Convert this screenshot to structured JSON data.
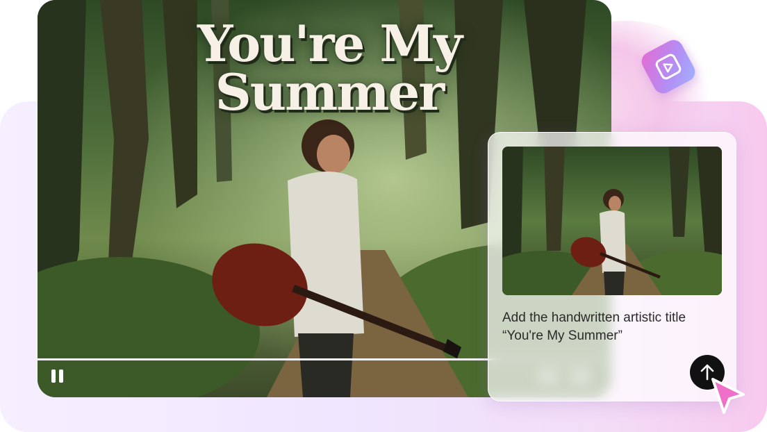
{
  "video": {
    "title_line1": "You're My",
    "title_line2": "Summer",
    "progress": 0.8,
    "play_state": "paused",
    "pause_icon": "pause-icon"
  },
  "logo": {
    "icon": "play-triangle-icon",
    "colors": [
      "#e46bd4",
      "#b58cf2",
      "#9fb2ff"
    ]
  },
  "prompt_card": {
    "text_line1": "Add the handwritten artistic title",
    "text_line2": "“You're My Summer”",
    "send_icon": "arrow-up-icon"
  },
  "cursor": {
    "icon": "mouse-pointer-icon",
    "color": "#f06fc9"
  },
  "colors": {
    "accent_pink": "#f06fc9",
    "background_lavender": "#efe6ff",
    "send_button": "#111111"
  }
}
